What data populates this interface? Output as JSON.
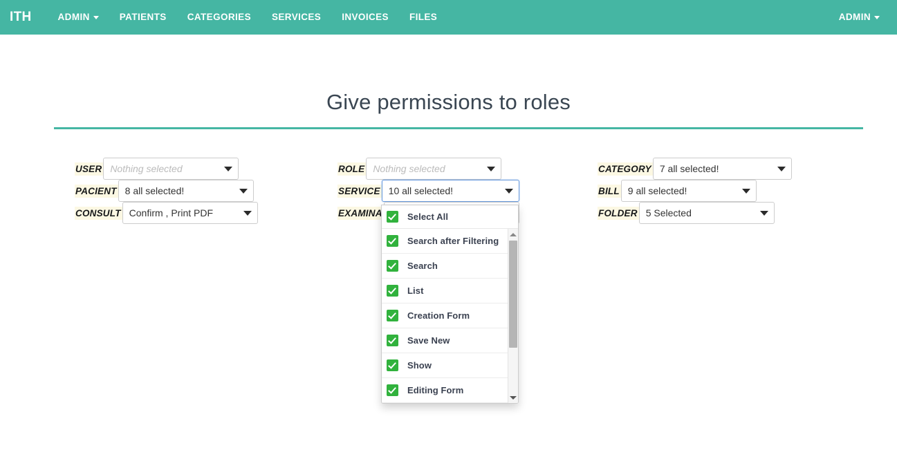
{
  "navbar": {
    "brand": "ITH",
    "items": [
      {
        "label": "ADMIN",
        "has_caret": true
      },
      {
        "label": "PATIENTS",
        "has_caret": false
      },
      {
        "label": "CATEGORIES",
        "has_caret": false
      },
      {
        "label": "SERVICES",
        "has_caret": false
      },
      {
        "label": "INVOICES",
        "has_caret": false
      },
      {
        "label": "FILES",
        "has_caret": false
      }
    ],
    "user_menu": {
      "label": "ADMIN",
      "has_caret": true
    },
    "background_color": "#45b6a3"
  },
  "page": {
    "title": "Give permissions to roles",
    "rule_color": "#45b6a3"
  },
  "form": {
    "columns": [
      {
        "name": "left",
        "rows": [
          {
            "label": "USER",
            "value": "Nothing selected",
            "is_placeholder": true,
            "focused": false
          },
          {
            "label": "PACIENT",
            "value": "8 all selected!",
            "is_placeholder": false,
            "focused": false
          },
          {
            "label": "CONSULT",
            "value": "Confirm , Print PDF",
            "is_placeholder": false,
            "focused": false
          }
        ]
      },
      {
        "name": "middle",
        "rows": [
          {
            "label": "ROLE",
            "value": "Nothing selected",
            "is_placeholder": true,
            "focused": false
          },
          {
            "label": "SERVICE",
            "value": "10 all selected!",
            "is_placeholder": false,
            "focused": true
          },
          {
            "label": "EXAMINA",
            "value": "",
            "is_placeholder": false,
            "focused": false
          }
        ]
      },
      {
        "name": "right",
        "rows": [
          {
            "label": "CATEGORY",
            "value": "7 all selected!",
            "is_placeholder": false,
            "focused": false
          },
          {
            "label": "BILL",
            "value": "9 all selected!",
            "is_placeholder": false,
            "focused": false
          },
          {
            "label": "FOLDER",
            "value": "5 Selected",
            "is_placeholder": false,
            "focused": false
          }
        ]
      }
    ]
  },
  "open_dropdown": {
    "owner": "SERVICE",
    "select_all_label": "Select All",
    "select_all_checked": true,
    "checkbox_color": "#31b23d",
    "items": [
      {
        "label": "Search after Filtering",
        "checked": true
      },
      {
        "label": "Search",
        "checked": true
      },
      {
        "label": "List",
        "checked": true
      },
      {
        "label": "Creation Form",
        "checked": true
      },
      {
        "label": "Save New",
        "checked": true
      },
      {
        "label": "Show",
        "checked": true
      },
      {
        "label": "Editing Form",
        "checked": true
      }
    ],
    "scrollbar": {
      "up_icon": "arrow-up-icon",
      "down_icon": "arrow-down-icon"
    }
  }
}
